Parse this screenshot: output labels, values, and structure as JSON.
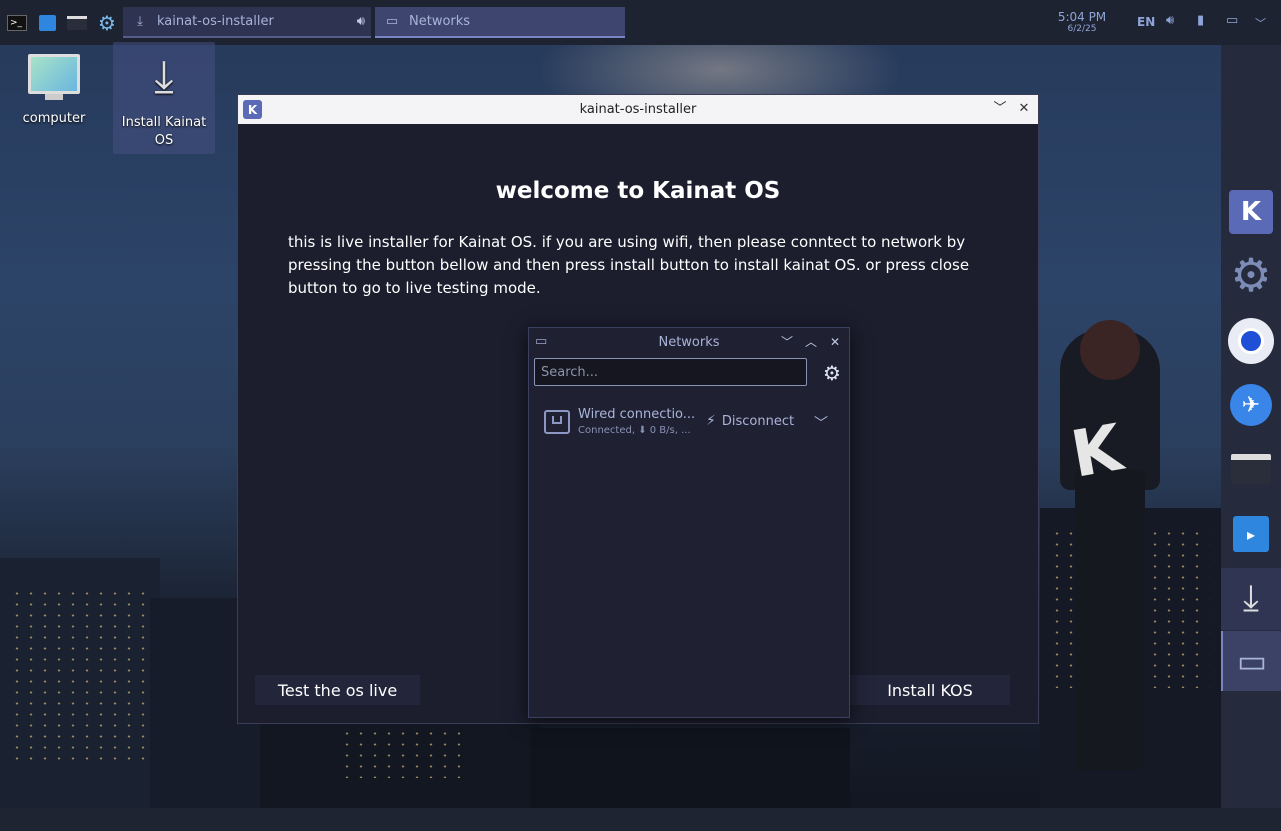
{
  "taskbar": {
    "installer_task": "kainat-os-installer",
    "networks_task": "Networks",
    "clock_time": "5:04 PM",
    "clock_date": "6/2/25",
    "keyboard_layout": "EN"
  },
  "desktop": {
    "computer_label": "computer",
    "install_label_1": "Install Kainat",
    "install_label_2": "OS"
  },
  "installer": {
    "window_title": "kainat-os-installer",
    "heading": "welcome to Kainat OS",
    "intro": "this is live installer for Kainat OS. if you are using wifi, then please conntect to network by pressing the button bellow and then press install button to install kainat OS. or press close button to go to live testing mode.",
    "test_button": "Test the os live",
    "install_button": "Install KOS"
  },
  "networks": {
    "title": "Networks",
    "search_placeholder": "Search...",
    "connection_name": "Wired connectio...",
    "connection_status": "Connected, ⬇ 0 B/s, ...",
    "disconnect_label": "Disconnect"
  },
  "colors": {
    "accent": "#5a6ab6",
    "panel": "#1e2331",
    "window_bg": "#1c1d2d"
  }
}
